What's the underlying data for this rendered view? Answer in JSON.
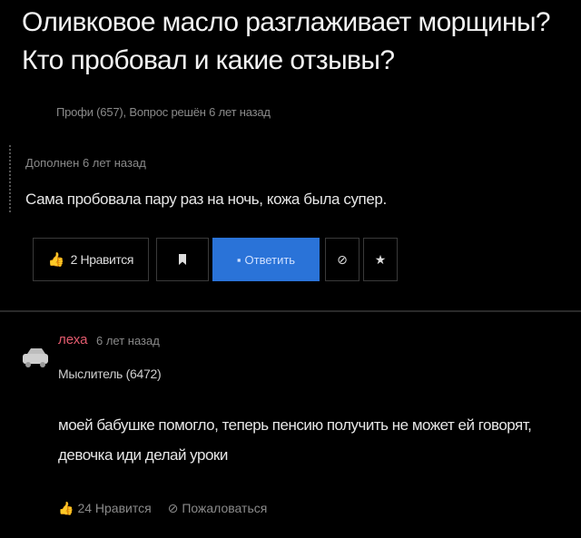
{
  "question": {
    "title": "Оливковое масло разглаживает морщины?Кто пробовал и какие отзывы?",
    "meta": "Профи (657), Вопрос решён 6 лет назад",
    "addition_label": "Дополнен 6 лет назад",
    "addition_text": "Сама пробовала пару раз на ночь, кожа была супер.",
    "like_label": "2 Нравится",
    "reply_label": "Ответить"
  },
  "answer": {
    "author": "леха",
    "time": "6 лет назад",
    "rank": "Мыслитель (6472)",
    "text": "моей бабушке помогло, теперь пенсию получить не может ей говорят, девочка иди делай уроки",
    "like_label": "24 Нравится",
    "report_label": "Пожаловаться"
  },
  "colors": {
    "background": "#000000",
    "accent_blue": "#2a73d8",
    "author_red": "#e35b6e"
  },
  "icons": {
    "like": "thumbs-up-icon",
    "bookmark": "bookmark-icon",
    "reply": "comment-icon",
    "block": "block-icon",
    "star": "star-icon",
    "report": "report-icon",
    "avatar": "car-avatar"
  }
}
